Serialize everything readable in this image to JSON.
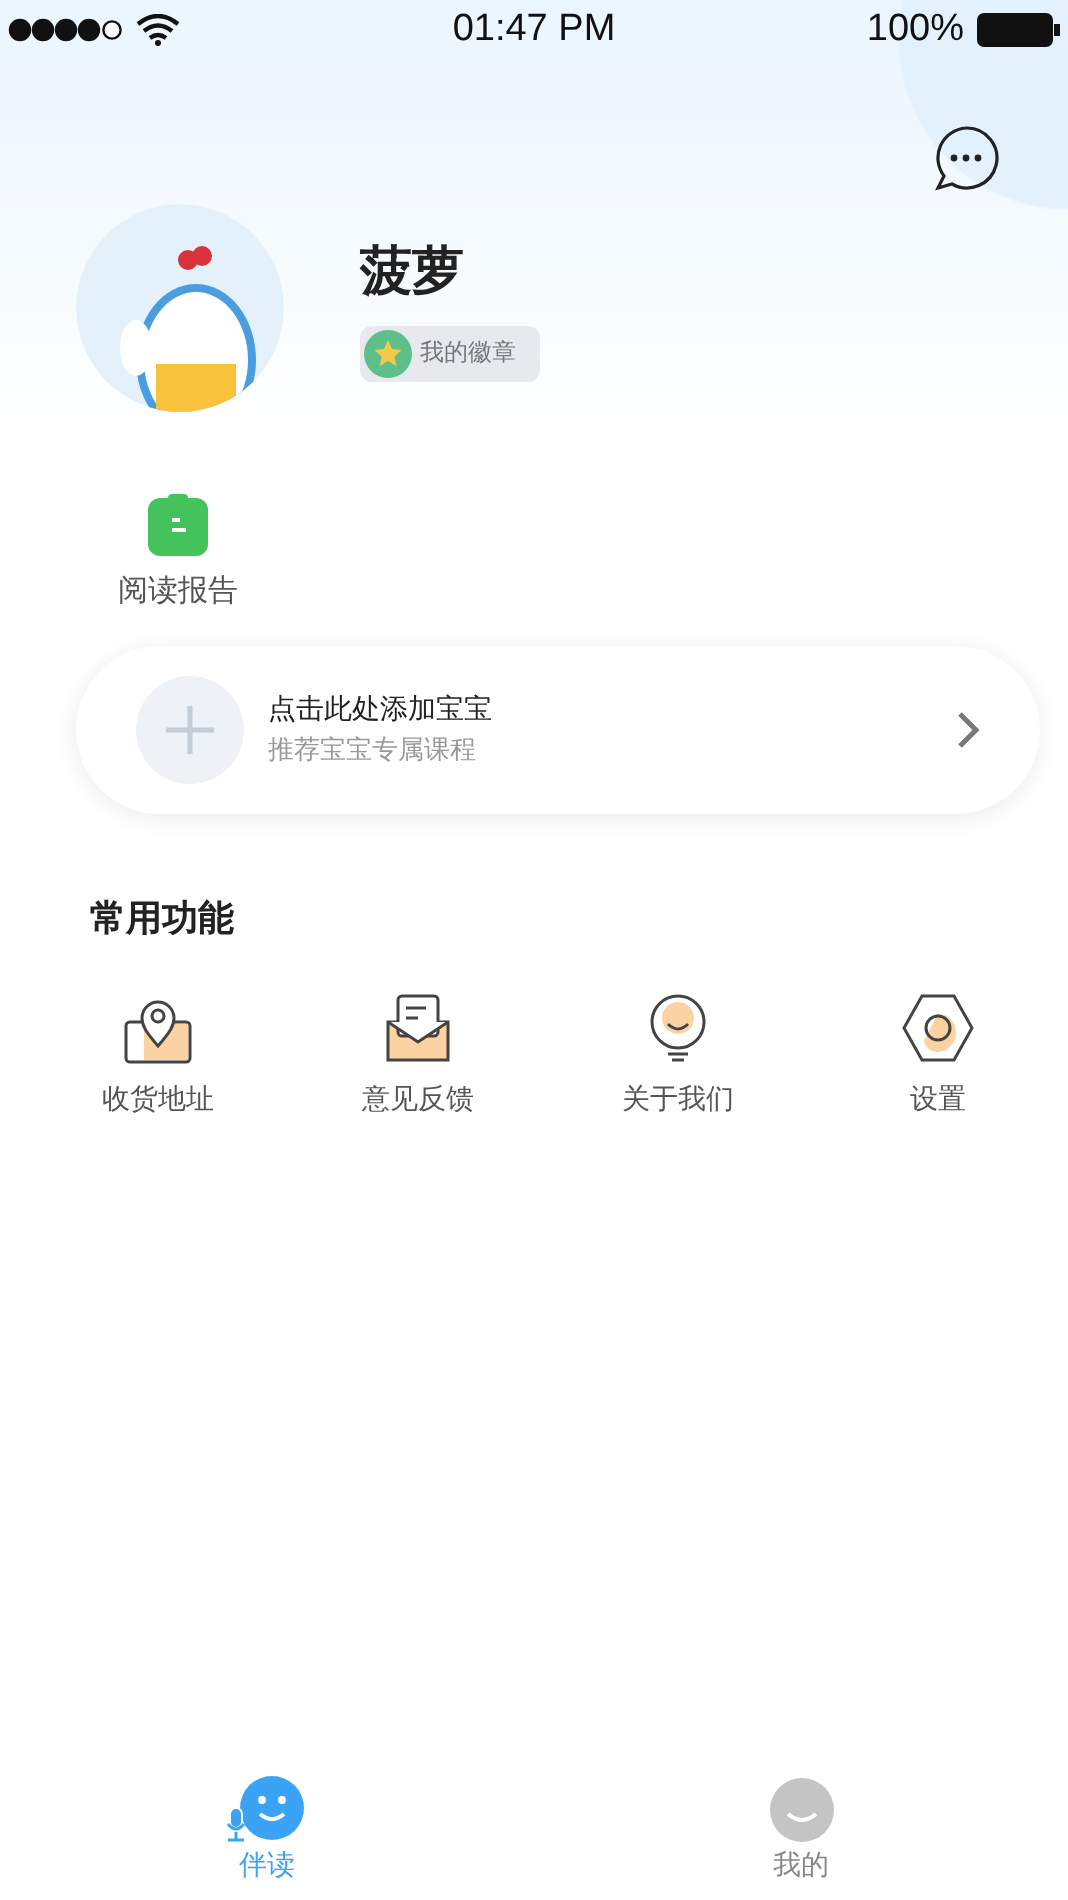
{
  "status_bar": {
    "time": "01:47 PM",
    "battery": "100%"
  },
  "profile": {
    "name": "菠萝",
    "badge": "我的徽章"
  },
  "shortcuts": [
    {
      "label": "阅读报告"
    }
  ],
  "add_child_card": {
    "title": "点击此处添加宝宝",
    "subtitle": "推荐宝宝专属课程"
  },
  "common_functions": {
    "title": "常用功能",
    "items": [
      {
        "kind": "address",
        "label": "收货地址"
      },
      {
        "kind": "feedback",
        "label": "意见反馈"
      },
      {
        "kind": "about",
        "label": "关于我们"
      },
      {
        "kind": "settings",
        "label": "设置"
      }
    ]
  },
  "tab_bar": [
    {
      "kind": "companion",
      "label": "伴读",
      "selected": true
    },
    {
      "kind": "me",
      "label": "我的",
      "selected": false
    }
  ]
}
